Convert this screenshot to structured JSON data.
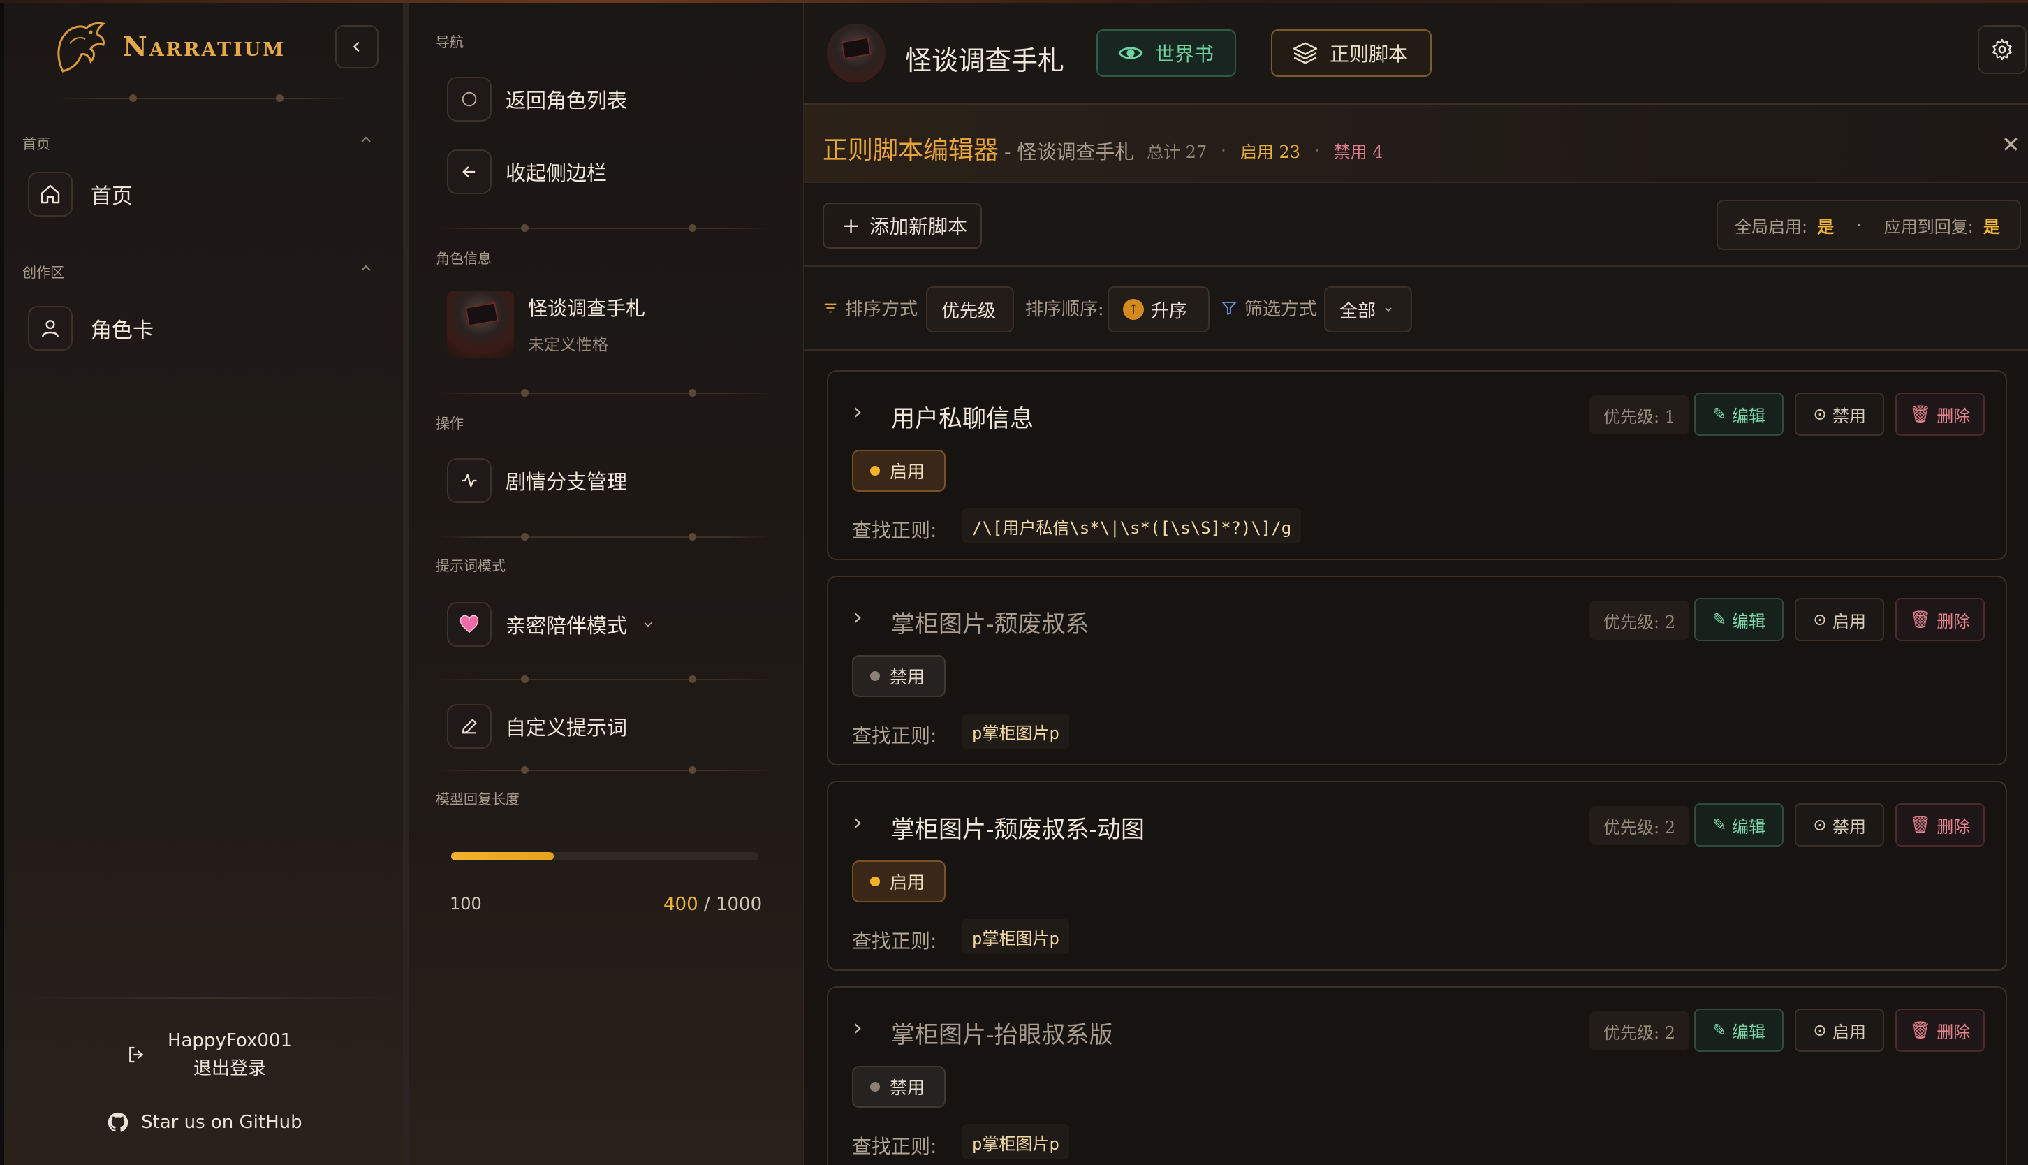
{
  "brand": "Narratium",
  "sidebar": {
    "sections": [
      {
        "label": "首页",
        "items": [
          {
            "label": "首页",
            "icon": "home-icon"
          }
        ]
      },
      {
        "label": "创作区",
        "items": [
          {
            "label": "角色卡",
            "icon": "user-icon"
          }
        ]
      }
    ],
    "username": "HappyFox001",
    "logout": "退出登录",
    "github": "Star us on GitHub"
  },
  "panel": {
    "nav_label": "导航",
    "back": "返回角色列表",
    "collapse": "收起侧边栏",
    "char_info_label": "角色信息",
    "char_name": "怪谈调查手札",
    "char_personality": "未定义性格",
    "ops_label": "操作",
    "story": "剧情分支管理",
    "prompt_mode_label": "提示词模式",
    "prompt_mode": "亲密陪伴模式",
    "custom_prompt": "自定义提示词",
    "length_label": "模型回复长度",
    "length_min": "100",
    "length_value": "400",
    "length_sep": " / ",
    "length_max": "1000",
    "length_fraction": 0.333
  },
  "topbar": {
    "title": "怪谈调查手札",
    "worldbook": "世界书",
    "regex": "正则脚本"
  },
  "editor": {
    "title": "正则脚本编辑器",
    "subtitle": "- 怪谈调查手札",
    "total": "总计 27",
    "enabled": "启用 23",
    "disabled": "禁用 4",
    "add": "添加新脚本",
    "global_label": "全局启用:",
    "global_value": "是",
    "apply_label": "应用到回复:",
    "apply_value": "是",
    "sort_label": "排序方式",
    "sort_value": "优先级",
    "order_label": "排序顺序:",
    "order_value": "升序",
    "filter_label": "筛选方式",
    "filter_value": "全部",
    "find_label": "查找正则:",
    "edit": "编辑",
    "delete": "删除"
  },
  "scripts": [
    {
      "name": "用户私聊信息",
      "priority": "优先级: 1",
      "status": "启用",
      "toggle": "禁用",
      "regex": "/\\[用户私信\\s*\\|\\s*([\\s\\S]*?)\\]/g"
    },
    {
      "name": "掌柜图片-颓废叔系",
      "priority": "优先级: 2",
      "status": "禁用",
      "toggle": "启用",
      "regex": "p掌柜图片p"
    },
    {
      "name": "掌柜图片-颓废叔系-动图",
      "priority": "优先级: 2",
      "status": "启用",
      "toggle": "禁用",
      "regex": "p掌柜图片p"
    },
    {
      "name": "掌柜图片-抬眼叔系版",
      "priority": "优先级: 2",
      "status": "禁用",
      "toggle": "启用",
      "regex": "p掌柜图片p"
    }
  ],
  "colors": {
    "accent": "#e8a53c",
    "enabled": "#f2b22c",
    "edit": "#7cd4a8",
    "delete": "#e6858f"
  }
}
